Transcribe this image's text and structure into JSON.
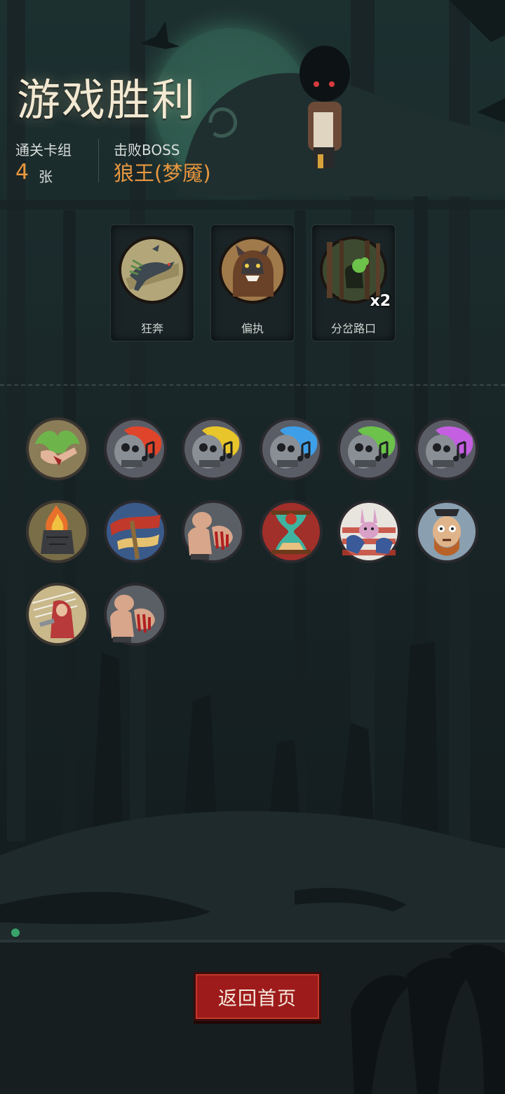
{
  "result": {
    "title": "游戏胜利",
    "deck_label": "通关卡组",
    "deck_count": "4",
    "deck_unit": "张",
    "boss_label": "击败BOSS",
    "boss_name": "狼王(梦魇)"
  },
  "boss_cards": [
    {
      "name": "狂奔",
      "icon": "running-wolf-icon",
      "multiplier": ""
    },
    {
      "name": "偏执",
      "icon": "werewolf-portrait-icon",
      "multiplier": ""
    },
    {
      "name": "分岔路口",
      "icon": "forest-crossroads-icon",
      "multiplier": "x2"
    }
  ],
  "deck_cards": [
    {
      "icon": "green-fire-limb-icon",
      "color": "#6db54a"
    },
    {
      "icon": "skull-note-red-icon",
      "color": "#e0452b"
    },
    {
      "icon": "skull-note-yellow-icon",
      "color": "#e8c52a"
    },
    {
      "icon": "skull-note-blue-icon",
      "color": "#3e9fe8"
    },
    {
      "icon": "skull-note-green-icon",
      "color": "#6cc24a"
    },
    {
      "icon": "skull-note-purple-icon",
      "color": "#c35fe0"
    },
    {
      "icon": "burning-altar-icon",
      "color": "#e8702a"
    },
    {
      "icon": "swirling-ribbon-icon",
      "color": "#c0392b"
    },
    {
      "icon": "bloody-fist-icon",
      "color": "#b33a3a"
    },
    {
      "icon": "hourglass-icon",
      "color": "#3fb3a0"
    },
    {
      "icon": "rabbit-character-icon",
      "color": "#d9a0c8"
    },
    {
      "icon": "pirate-face-icon",
      "color": "#b88a3a"
    },
    {
      "icon": "red-hood-icon",
      "color": "#b83a3a"
    },
    {
      "icon": "bloody-fist-icon",
      "color": "#b33a3a"
    }
  ],
  "actions": {
    "return_label": "返回首页"
  }
}
